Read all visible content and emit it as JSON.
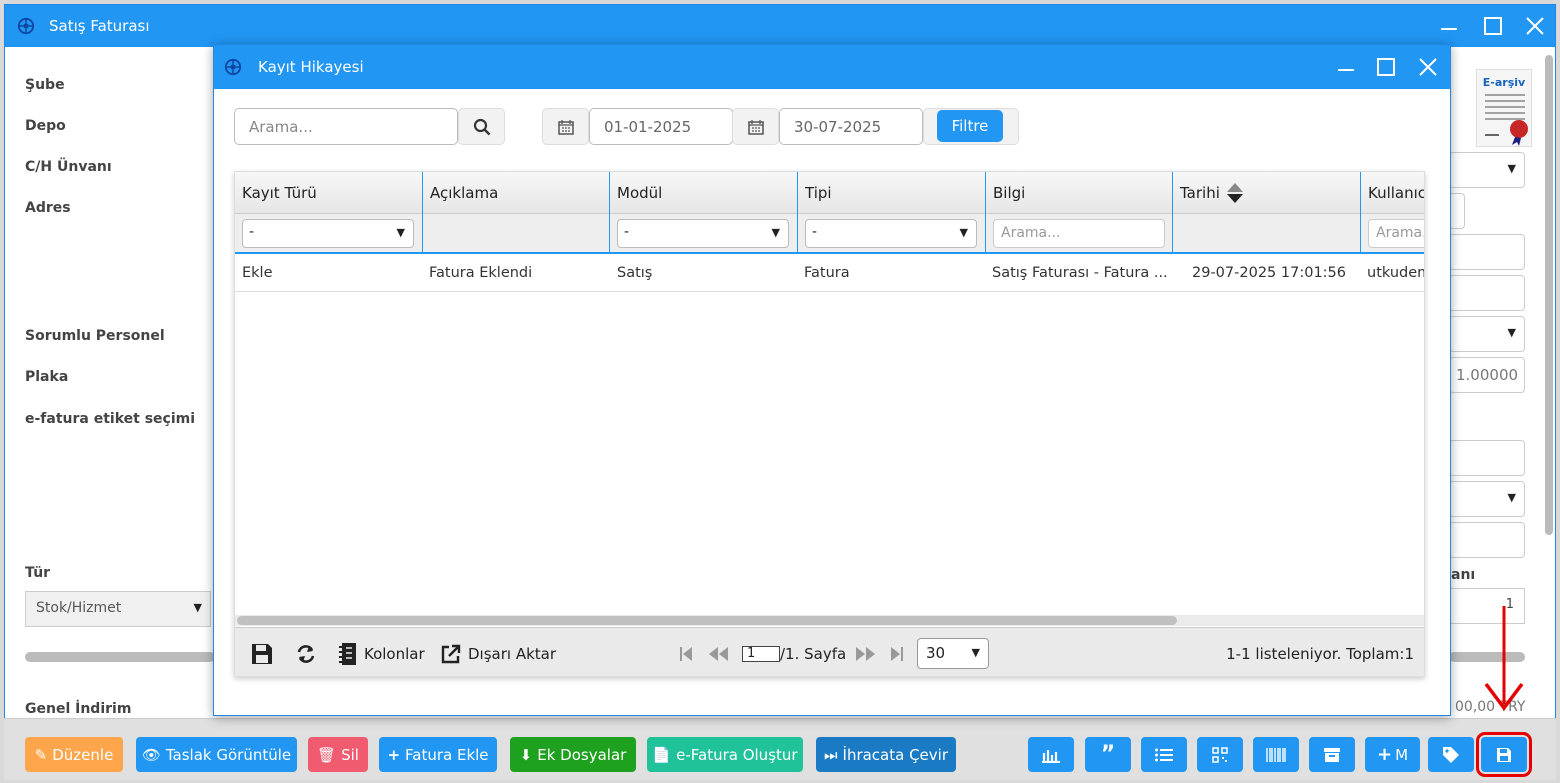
{
  "main_window": {
    "title": "Satış Faturası",
    "labels": {
      "sube": "Şube",
      "depo": "Depo",
      "ch_unvani": "C/H Ünvanı",
      "adres": "Adres",
      "sorumlu_personel": "Sorumlu Personel",
      "plaka": "Plaka",
      "efatura_etiket": "e-fatura etiket seçimi",
      "tur": "Tür",
      "genel_indirim": "Genel İndirim",
      "right_partial_label": "anı"
    },
    "tur_value": "Stok/Hizmet",
    "right_values": {
      "kur": "1.00000",
      "qty": "1",
      "total": "00,00 TRY"
    },
    "earsiv_label": "E-arşiv"
  },
  "dialog": {
    "title": "Kayıt Hikayesi",
    "search_placeholder": "Arama...",
    "date_from": "01-01-2025",
    "date_to": "30-07-2025",
    "filter_button": "Filtre",
    "columns": [
      "Kayıt Türü",
      "Açıklama",
      "Modül",
      "Tipi",
      "Bilgi",
      "Tarihi",
      "Kullanıcı"
    ],
    "column_filters": {
      "kayit_turu": "-",
      "modul": "-",
      "tipi": "-",
      "bilgi_placeholder": "Arama...",
      "kullanici_placeholder": "Arama..."
    },
    "rows": [
      {
        "kayit_turu": "Ekle",
        "aciklama": "Fatura Eklendi",
        "modul": "Satış",
        "tipi": "Fatura",
        "bilgi": "Satış Faturası - Fatura ...",
        "tarihi": "29-07-2025 17:01:56",
        "kullanici": "utkudem"
      }
    ],
    "footer": {
      "kolonlar": "Kolonlar",
      "disari_aktar": "Dışarı Aktar",
      "page_current": "1",
      "page_suffix": "/1. Sayfa",
      "page_size": "30",
      "summary": "1-1 listeleniyor. Toplam:1"
    }
  },
  "bottom_buttons": {
    "duzenle": "Düzenle",
    "taslak": "Taslak Görüntüle",
    "sil": "Sil",
    "fatura_ekle": "Fatura Ekle",
    "ek_dosyalar": "Ek Dosyalar",
    "efatura_olustur": "e-Fatura Oluştur",
    "ihracata_cevir": "İhracata Çevir",
    "plus_m": "M"
  },
  "colors": {
    "primary": "#2196f3",
    "orange": "#ffa64d",
    "red": "#f05b6f",
    "green": "#1ea11e",
    "teal": "#20c29a",
    "darkblue": "#1a7bc4",
    "highlight": "#e60000"
  }
}
